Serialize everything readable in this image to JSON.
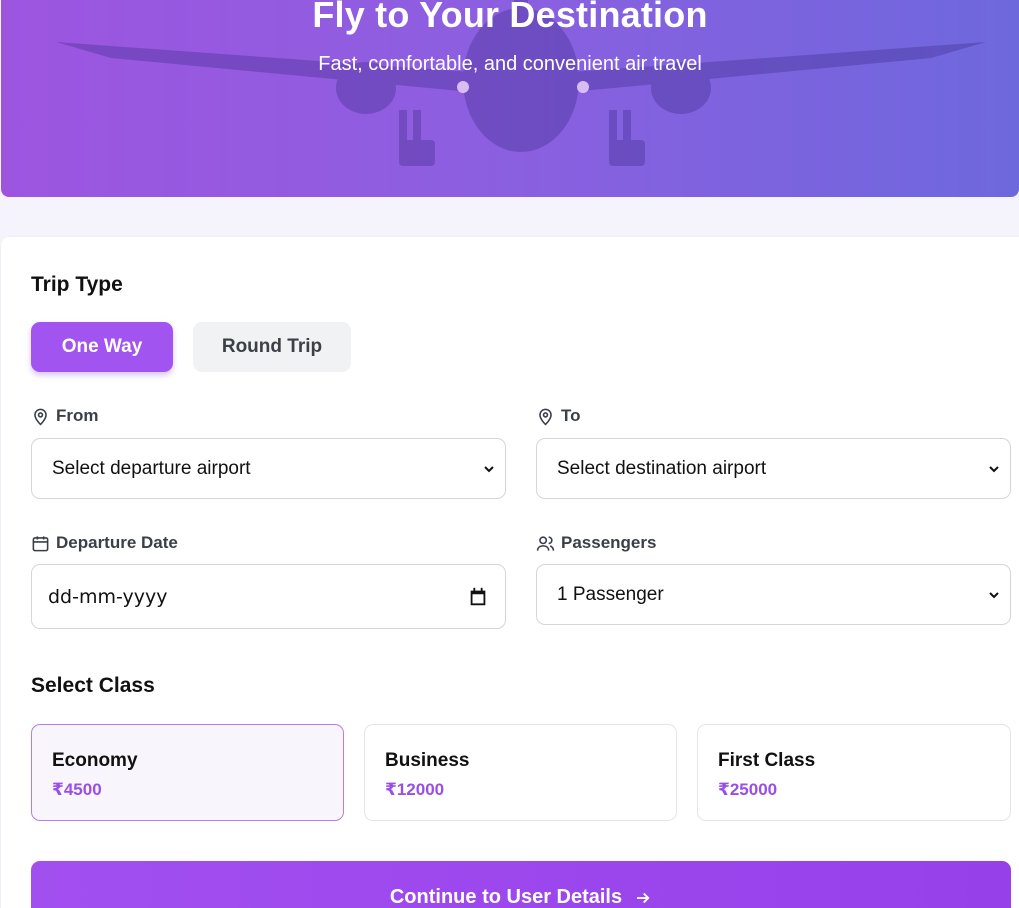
{
  "hero": {
    "title": "Fly to Your Destination",
    "subtitle": "Fast, comfortable, and convenient air travel"
  },
  "trip_type": {
    "title": "Trip Type",
    "options": [
      {
        "label": "One Way",
        "active": true
      },
      {
        "label": "Round Trip",
        "active": false
      }
    ]
  },
  "from": {
    "label": "From",
    "value": "Select departure airport",
    "icon": "map-pin-icon"
  },
  "to": {
    "label": "To",
    "value": "Select destination airport",
    "icon": "map-pin-icon"
  },
  "departure_date": {
    "label": "Departure Date",
    "placeholder": "dd-mm-yyyy",
    "icon": "calendar-icon"
  },
  "passengers": {
    "label": "Passengers",
    "value": "1 Passenger",
    "icon": "users-icon"
  },
  "class_section": {
    "title": "Select Class",
    "options": [
      {
        "name": "Economy",
        "price": "₹4500",
        "selected": true
      },
      {
        "name": "Business",
        "price": "₹12000",
        "selected": false
      },
      {
        "name": "First Class",
        "price": "₹25000",
        "selected": false
      }
    ]
  },
  "continue_button": {
    "label": "Continue to User Details",
    "icon": "arrow-right-icon"
  },
  "colors": {
    "accent": "#a154ef",
    "price": "#9a4ee8",
    "hero_start": "#9d55e0",
    "hero_end": "#6e68dd"
  }
}
